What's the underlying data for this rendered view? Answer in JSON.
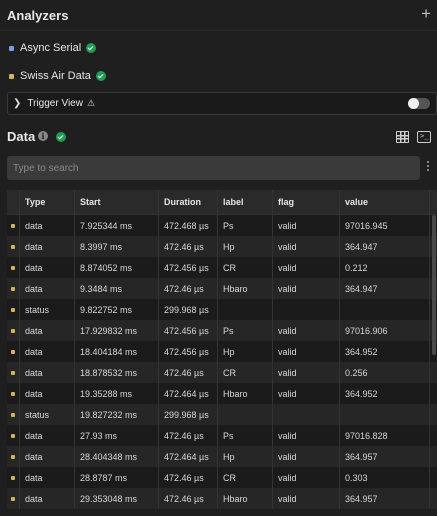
{
  "header": {
    "title": "Analyzers",
    "add_symbol": "+"
  },
  "analyzers": [
    {
      "name": "Async Serial",
      "color": "#7e9be6"
    },
    {
      "name": "Swiss Air Data",
      "color": "#d6b25e"
    }
  ],
  "trigger": {
    "label": "Trigger View",
    "warn_symbol": "⚠",
    "enabled": false
  },
  "data_section": {
    "title": "Data",
    "info_symbol": "i",
    "terminal_symbol": ">_"
  },
  "search": {
    "placeholder": "Type to search",
    "value": ""
  },
  "table": {
    "columns": [
      "Type",
      "Start",
      "Duration",
      "label",
      "flag",
      "value"
    ],
    "rows": [
      [
        "data",
        "7.925344 ms",
        "472.468 µs",
        "Ps",
        "valid",
        "97016.945"
      ],
      [
        "data",
        "8.3997 ms",
        "472.46 µs",
        "Hp",
        "valid",
        "364.947"
      ],
      [
        "data",
        "8.874052 ms",
        "472.456 µs",
        "CR",
        "valid",
        "0.212"
      ],
      [
        "data",
        "9.3484 ms",
        "472.46 µs",
        "Hbaro",
        "valid",
        "364.947"
      ],
      [
        "status",
        "9.822752 ms",
        "299.968 µs",
        "",
        "",
        ""
      ],
      [
        "data",
        "17.929832 ms",
        "472.456 µs",
        "Ps",
        "valid",
        "97016.906"
      ],
      [
        "data",
        "18.404184 ms",
        "472.456 µs",
        "Hp",
        "valid",
        "364.952"
      ],
      [
        "data",
        "18.878532 ms",
        "472.46 µs",
        "CR",
        "valid",
        "0.256"
      ],
      [
        "data",
        "19.35288 ms",
        "472.464 µs",
        "Hbaro",
        "valid",
        "364.952"
      ],
      [
        "status",
        "19.827232 ms",
        "299.968 µs",
        "",
        "",
        ""
      ],
      [
        "data",
        "27.93 ms",
        "472.46 µs",
        "Ps",
        "valid",
        "97016.828"
      ],
      [
        "data",
        "28.404348 ms",
        "472.464 µs",
        "Hp",
        "valid",
        "364.957"
      ],
      [
        "data",
        "28.8787 ms",
        "472.46 µs",
        "CR",
        "valid",
        "0.303"
      ],
      [
        "data",
        "29.353048 ms",
        "472.46 µs",
        "Hbaro",
        "valid",
        "364.957"
      ]
    ]
  },
  "colors": {
    "row_marker": "#d6b25e",
    "check_green": "#1f9d55"
  }
}
